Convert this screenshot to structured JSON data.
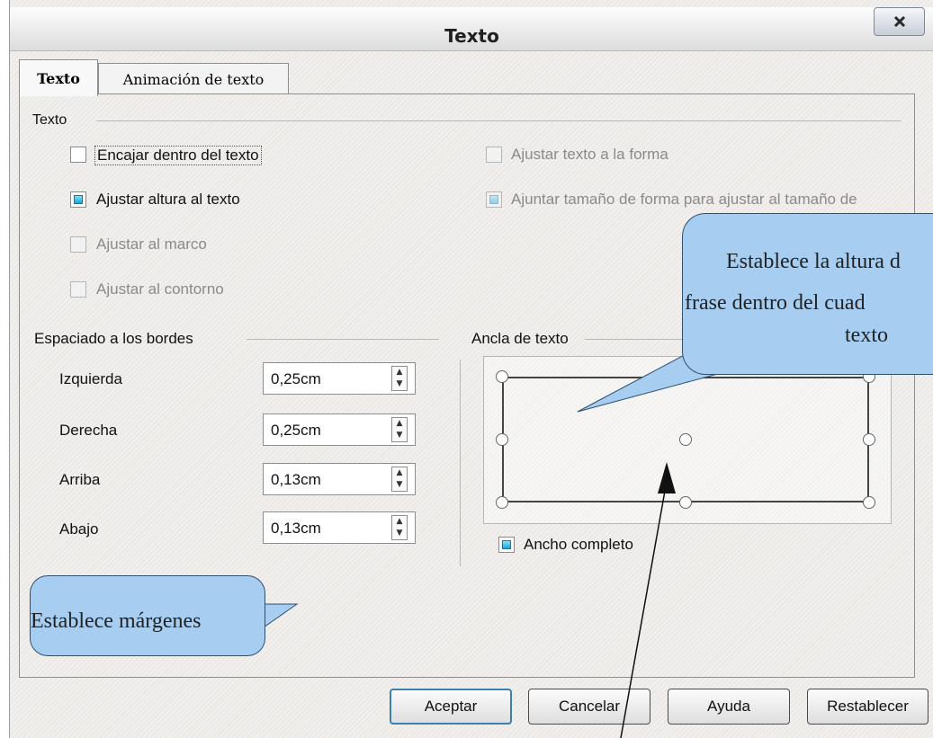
{
  "window": {
    "title": "Texto"
  },
  "tabs": [
    {
      "label": "Texto"
    },
    {
      "label": "Animación de texto"
    }
  ],
  "sections": {
    "texto": "Texto",
    "espaciado": "Espaciado a los bordes",
    "ancla": "Ancla de texto"
  },
  "checkboxes": {
    "encajar": "Encajar dentro del texto",
    "ajustar_altura": "Ajustar altura al texto",
    "ajustar_marco": "Ajustar al marco",
    "ajustar_contorno": "Ajustar al contorno",
    "ajustar_forma": "Ajustar texto a la forma",
    "ajuntar_tamano": "Ajuntar tamaño de forma para ajustar al tamaño de",
    "ancho_completo": "Ancho completo"
  },
  "spacing": [
    {
      "label": "Izquierda",
      "value": "0,25cm"
    },
    {
      "label": "Derecha",
      "value": "0,25cm"
    },
    {
      "label": "Arriba",
      "value": "0,13cm"
    },
    {
      "label": "Abajo",
      "value": "0,13cm"
    }
  ],
  "buttons": {
    "aceptar": "Aceptar",
    "cancelar": "Cancelar",
    "ayuda": "Ayuda",
    "restablecer": "Restablecer"
  },
  "callouts": {
    "altura_line1": "Establece la altura d",
    "altura_line2": "frase dentro del cuad",
    "altura_line3": "texto",
    "margenes": "Establece márgenes"
  },
  "colors": {
    "callout_fill": "#a7cdf0",
    "check_accent": "#1aa6d6"
  }
}
